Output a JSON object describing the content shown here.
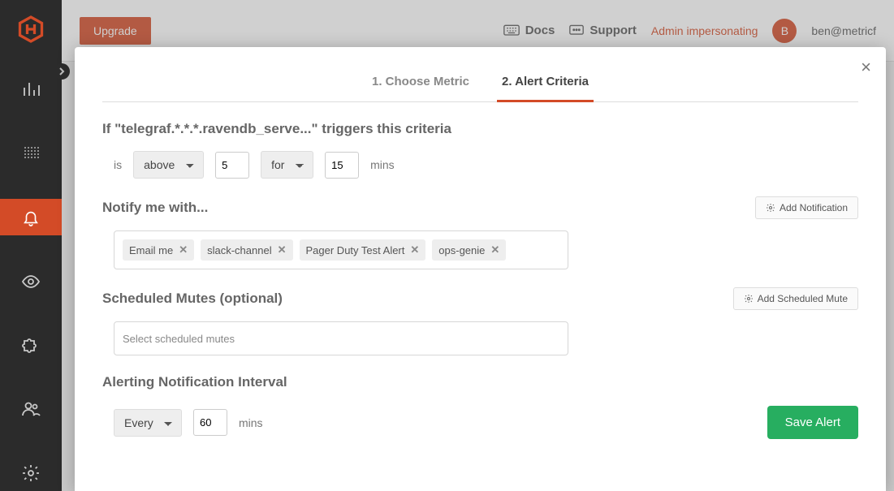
{
  "topbar": {
    "upgrade_label": "Upgrade",
    "docs_label": "Docs",
    "support_label": "Support",
    "impersonate_label": "Admin impersonating",
    "avatar_initial": "B",
    "user_email": "ben@metricf"
  },
  "modal": {
    "close_glyph": "×",
    "tabs": {
      "choose_metric": "1. Choose Metric",
      "alert_criteria": "2. Alert Criteria"
    },
    "criteria_heading": "If \"telegraf.*.*.*.ravendb_serve...\" triggers this criteria",
    "is_label": "is",
    "comparator_value": "above",
    "threshold_value": "5",
    "duration_mode": "for",
    "duration_value": "15",
    "mins_label": "mins",
    "notify_heading": "Notify me with...",
    "add_notification_label": "Add Notification",
    "notifications": [
      {
        "label": "Email me"
      },
      {
        "label": "slack-channel"
      },
      {
        "label": "Pager Duty Test Alert"
      },
      {
        "label": "ops-genie"
      }
    ],
    "mutes_heading": "Scheduled Mutes (optional)",
    "add_mute_label": "Add Scheduled Mute",
    "mutes_placeholder": "Select scheduled mutes",
    "interval_heading": "Alerting Notification Interval",
    "interval_mode": "Every",
    "interval_value": "60",
    "save_label": "Save Alert"
  }
}
